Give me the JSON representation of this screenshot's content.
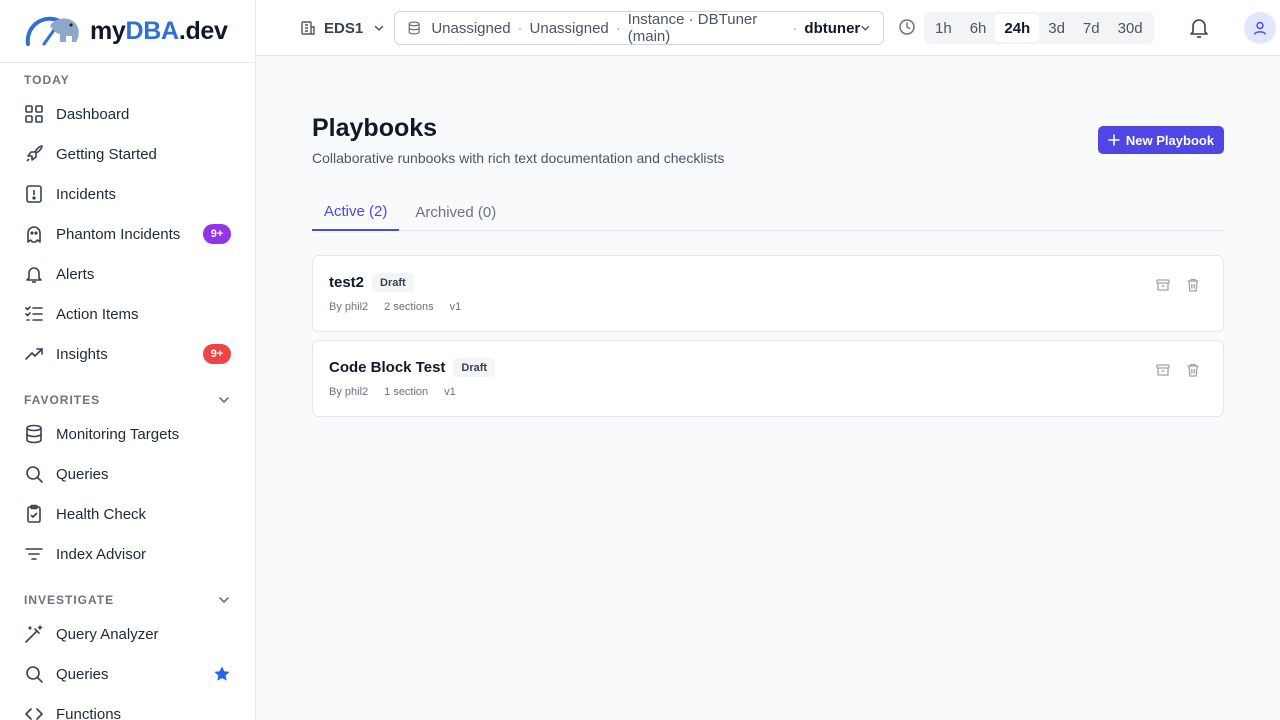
{
  "brand": {
    "part1": "my",
    "part2": "DBA",
    "part3": ".dev"
  },
  "sidebar": {
    "sections": [
      {
        "title": "TODAY",
        "items": [
          {
            "label": "Dashboard"
          },
          {
            "label": "Getting Started"
          },
          {
            "label": "Incidents"
          },
          {
            "label": "Phantom Incidents",
            "badge": "9+"
          },
          {
            "label": "Alerts"
          },
          {
            "label": "Action Items"
          },
          {
            "label": "Insights",
            "badge": "9+"
          }
        ]
      },
      {
        "title": "FAVORITES",
        "items": [
          {
            "label": "Monitoring Targets"
          },
          {
            "label": "Queries"
          },
          {
            "label": "Health Check"
          },
          {
            "label": "Index Advisor"
          }
        ]
      },
      {
        "title": "INVESTIGATE",
        "items": [
          {
            "label": "Query Analyzer"
          },
          {
            "label": "Queries"
          },
          {
            "label": "Functions"
          }
        ]
      }
    ]
  },
  "topbar": {
    "org": "EDS1",
    "context": {
      "a": "Unassigned",
      "b": "Unassigned",
      "c": "Instance · DBTuner (main)",
      "d": "dbtuner"
    },
    "ranges": [
      "1h",
      "6h",
      "24h",
      "3d",
      "7d",
      "30d"
    ],
    "active_range": "24h"
  },
  "page": {
    "title": "Playbooks",
    "subtitle": "Collaborative runbooks with rich text documentation and checklists",
    "new_button": "New Playbook",
    "tabs": [
      "Active (2)",
      "Archived (0)"
    ]
  },
  "playbooks": [
    {
      "name": "test2",
      "status": "Draft",
      "author": "By phil2",
      "sections": "2 sections",
      "version": "v1"
    },
    {
      "name": "Code Block Test",
      "status": "Draft",
      "author": "By phil2",
      "sections": "1 section",
      "version": "v1"
    }
  ],
  "colors": {
    "accent": "#4f46e5",
    "brand_blue": "#2f6fd6",
    "badge_purple": "#9333ea",
    "badge_red": "#ef4444",
    "favorite_star": "#2563eb"
  }
}
